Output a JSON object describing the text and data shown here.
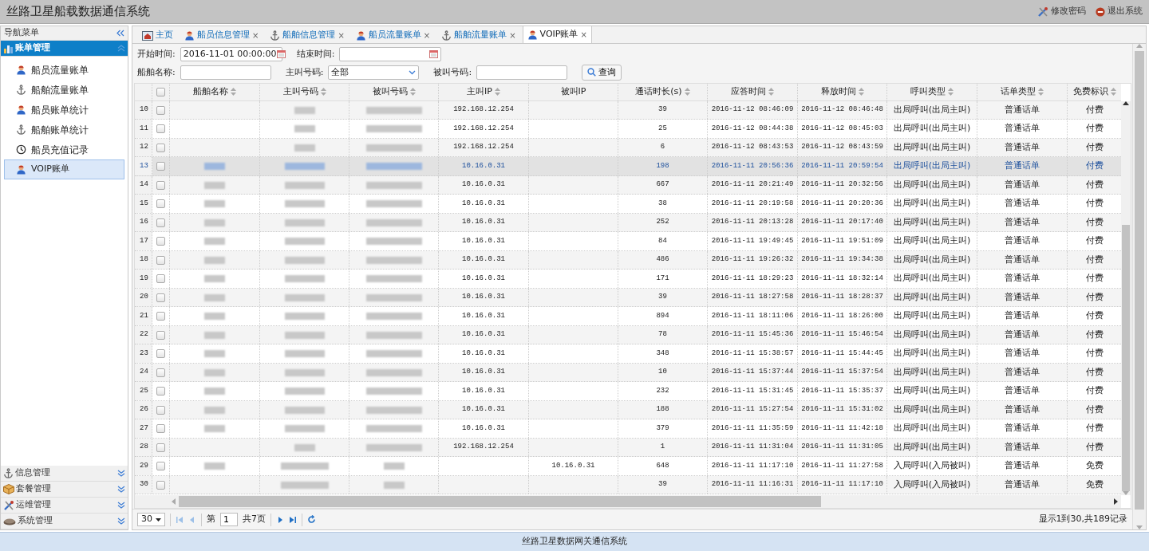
{
  "header": {
    "title": "丝路卫星船载数据通信系统",
    "actions": [
      {
        "label": "修改密码"
      },
      {
        "label": "退出系统"
      }
    ]
  },
  "sidebar": {
    "title": "导航菜单",
    "sections": [
      {
        "label": "账单管理",
        "expanded": true,
        "items": [
          {
            "label": "船员流量账单",
            "selected": false
          },
          {
            "label": "船舶流量账单",
            "selected": false
          },
          {
            "label": "船员账单统计",
            "selected": false
          },
          {
            "label": "船舶账单统计",
            "selected": false
          },
          {
            "label": "船员充值记录",
            "selected": false
          },
          {
            "label": "VOIP账单",
            "selected": true
          }
        ]
      },
      {
        "label": "信息管理",
        "expanded": false
      },
      {
        "label": "套餐管理",
        "expanded": false
      },
      {
        "label": "运维管理",
        "expanded": false
      },
      {
        "label": "系统管理",
        "expanded": false
      }
    ]
  },
  "tabs": [
    {
      "label": "主页",
      "selected": false
    },
    {
      "label": "船员信息管理",
      "close": "×",
      "selected": false
    },
    {
      "label": "船舶信息管理",
      "close": "×",
      "selected": false
    },
    {
      "label": "船员流量账单",
      "close": "×",
      "selected": false
    },
    {
      "label": "船舶流量账单",
      "close": "×",
      "selected": false
    },
    {
      "label": "VOIP账单",
      "close": "×",
      "selected": true
    }
  ],
  "filters": [
    [
      {
        "label": "开始时间:",
        "kind": "date",
        "value": "2016-11-01 00:00:00"
      },
      {
        "label": "结束时间:",
        "kind": "date"
      }
    ],
    [
      {
        "label": "船舶名称:",
        "kind": "text"
      },
      {
        "label": "主叫号码:",
        "kind": "select",
        "value": "全部"
      },
      {
        "label": "被叫号码:",
        "kind": "text"
      },
      {
        "kind": "button",
        "label": "查询"
      }
    ]
  ],
  "table": {
    "all_checked": false,
    "columns": [
      "船舶名称",
      "主叫号码",
      "被叫号码",
      "主叫IP",
      "被叫IP",
      "通话时长(s)",
      "应答时间",
      "释放时间",
      "呼叫类型",
      "话单类型",
      "免费标识"
    ],
    "rows": [
      {
        "num": "10",
        "checked": false,
        "selected": false,
        "redacted": [
          false,
          true,
          true
        ],
        "cells": [
          null,
          null,
          null,
          "192.168.12.254",
          null,
          "39",
          "2016-11-12 08:46:09",
          "2016-11-12 08:46:48",
          "出局呼叫(出局主叫)",
          "普通话单",
          "付费"
        ]
      },
      {
        "num": "11",
        "checked": false,
        "selected": false,
        "redacted": [
          false,
          true,
          true
        ],
        "cells": [
          null,
          null,
          null,
          "192.168.12.254",
          null,
          "25",
          "2016-11-12 08:44:38",
          "2016-11-12 08:45:03",
          "出局呼叫(出局主叫)",
          "普通话单",
          "付费"
        ]
      },
      {
        "num": "12",
        "checked": false,
        "selected": false,
        "redacted": [
          false,
          true,
          true
        ],
        "cells": [
          null,
          null,
          null,
          "192.168.12.254",
          null,
          "6",
          "2016-11-12 08:43:53",
          "2016-11-12 08:43:59",
          "出局呼叫(出局主叫)",
          "普通话单",
          "付费"
        ]
      },
      {
        "num": "13",
        "checked": false,
        "selected": true,
        "redacted": [
          true,
          true,
          true
        ],
        "cells": [
          null,
          null,
          null,
          "10.16.0.31",
          null,
          "198",
          "2016-11-11 20:56:36",
          "2016-11-11 20:59:54",
          "出局呼叫(出局主叫)",
          "普通话单",
          "付费"
        ]
      },
      {
        "num": "14",
        "checked": false,
        "selected": false,
        "redacted": [
          true,
          true,
          true
        ],
        "cells": [
          null,
          null,
          null,
          "10.16.0.31",
          null,
          "667",
          "2016-11-11 20:21:49",
          "2016-11-11 20:32:56",
          "出局呼叫(出局主叫)",
          "普通话单",
          "付费"
        ]
      },
      {
        "num": "15",
        "checked": false,
        "selected": false,
        "redacted": [
          true,
          true,
          true
        ],
        "cells": [
          null,
          null,
          null,
          "10.16.0.31",
          null,
          "38",
          "2016-11-11 20:19:58",
          "2016-11-11 20:20:36",
          "出局呼叫(出局主叫)",
          "普通话单",
          "付费"
        ]
      },
      {
        "num": "16",
        "checked": false,
        "selected": false,
        "redacted": [
          true,
          true,
          true
        ],
        "cells": [
          null,
          null,
          null,
          "10.16.0.31",
          null,
          "252",
          "2016-11-11 20:13:28",
          "2016-11-11 20:17:40",
          "出局呼叫(出局主叫)",
          "普通话单",
          "付费"
        ]
      },
      {
        "num": "17",
        "checked": false,
        "selected": false,
        "redacted": [
          true,
          true,
          true
        ],
        "cells": [
          null,
          null,
          null,
          "10.16.0.31",
          null,
          "84",
          "2016-11-11 19:49:45",
          "2016-11-11 19:51:09",
          "出局呼叫(出局主叫)",
          "普通话单",
          "付费"
        ]
      },
      {
        "num": "18",
        "checked": false,
        "selected": false,
        "redacted": [
          true,
          true,
          true
        ],
        "cells": [
          null,
          null,
          null,
          "10.16.0.31",
          null,
          "486",
          "2016-11-11 19:26:32",
          "2016-11-11 19:34:38",
          "出局呼叫(出局主叫)",
          "普通话单",
          "付费"
        ]
      },
      {
        "num": "19",
        "checked": false,
        "selected": false,
        "redacted": [
          true,
          true,
          true
        ],
        "cells": [
          null,
          null,
          null,
          "10.16.0.31",
          null,
          "171",
          "2016-11-11 18:29:23",
          "2016-11-11 18:32:14",
          "出局呼叫(出局主叫)",
          "普通话单",
          "付费"
        ]
      },
      {
        "num": "20",
        "checked": false,
        "selected": false,
        "redacted": [
          true,
          true,
          true
        ],
        "cells": [
          null,
          null,
          null,
          "10.16.0.31",
          null,
          "39",
          "2016-11-11 18:27:58",
          "2016-11-11 18:28:37",
          "出局呼叫(出局主叫)",
          "普通话单",
          "付费"
        ]
      },
      {
        "num": "21",
        "checked": false,
        "selected": false,
        "redacted": [
          true,
          true,
          true
        ],
        "cells": [
          null,
          null,
          null,
          "10.16.0.31",
          null,
          "894",
          "2016-11-11 18:11:06",
          "2016-11-11 18:26:00",
          "出局呼叫(出局主叫)",
          "普通话单",
          "付费"
        ]
      },
      {
        "num": "22",
        "checked": false,
        "selected": false,
        "redacted": [
          true,
          true,
          true
        ],
        "cells": [
          null,
          null,
          null,
          "10.16.0.31",
          null,
          "78",
          "2016-11-11 15:45:36",
          "2016-11-11 15:46:54",
          "出局呼叫(出局主叫)",
          "普通话单",
          "付费"
        ]
      },
      {
        "num": "23",
        "checked": false,
        "selected": false,
        "redacted": [
          true,
          true,
          true
        ],
        "cells": [
          null,
          null,
          null,
          "10.16.0.31",
          null,
          "348",
          "2016-11-11 15:38:57",
          "2016-11-11 15:44:45",
          "出局呼叫(出局主叫)",
          "普通话单",
          "付费"
        ]
      },
      {
        "num": "24",
        "checked": false,
        "selected": false,
        "redacted": [
          true,
          true,
          true
        ],
        "cells": [
          null,
          null,
          null,
          "10.16.0.31",
          null,
          "10",
          "2016-11-11 15:37:44",
          "2016-11-11 15:37:54",
          "出局呼叫(出局主叫)",
          "普通话单",
          "付费"
        ]
      },
      {
        "num": "25",
        "checked": false,
        "selected": false,
        "redacted": [
          true,
          true,
          true
        ],
        "cells": [
          null,
          null,
          null,
          "10.16.0.31",
          null,
          "232",
          "2016-11-11 15:31:45",
          "2016-11-11 15:35:37",
          "出局呼叫(出局主叫)",
          "普通话单",
          "付费"
        ]
      },
      {
        "num": "26",
        "checked": false,
        "selected": false,
        "redacted": [
          true,
          true,
          true
        ],
        "cells": [
          null,
          null,
          null,
          "10.16.0.31",
          null,
          "188",
          "2016-11-11 15:27:54",
          "2016-11-11 15:31:02",
          "出局呼叫(出局主叫)",
          "普通话单",
          "付费"
        ]
      },
      {
        "num": "27",
        "checked": false,
        "selected": false,
        "redacted": [
          true,
          true,
          true
        ],
        "cells": [
          null,
          null,
          null,
          "10.16.0.31",
          null,
          "379",
          "2016-11-11 11:35:59",
          "2016-11-11 11:42:18",
          "出局呼叫(出局主叫)",
          "普通话单",
          "付费"
        ]
      },
      {
        "num": "28",
        "checked": false,
        "selected": false,
        "redacted": [
          false,
          true,
          true
        ],
        "cells": [
          null,
          null,
          null,
          "192.168.12.254",
          null,
          "1",
          "2016-11-11 11:31:04",
          "2016-11-11 11:31:05",
          "出局呼叫(出局主叫)",
          "普通话单",
          "付费"
        ]
      },
      {
        "num": "29",
        "checked": false,
        "selected": false,
        "redacted": [
          true,
          true,
          true
        ],
        "cells": [
          null,
          null,
          null,
          null,
          "10.16.0.31",
          "648",
          "2016-11-11 11:17:10",
          "2016-11-11 11:27:58",
          "入局呼叫(入局被叫)",
          "普通话单",
          "免费"
        ]
      },
      {
        "num": "30",
        "checked": false,
        "selected": false,
        "redacted": [
          false,
          true,
          true
        ],
        "cells": [
          null,
          null,
          null,
          null,
          null,
          "39",
          "2016-11-11 11:16:31",
          "2016-11-11 11:17:10",
          "入局呼叫(入局被叫)",
          "普通话单",
          "免费"
        ]
      }
    ]
  },
  "pager": {
    "page_size": "30",
    "page_prefix": "第",
    "page": "1",
    "total": "共7页",
    "summary": "显示1到30,共189记录"
  },
  "footer": "丝路卫星数据网关通信系统"
}
